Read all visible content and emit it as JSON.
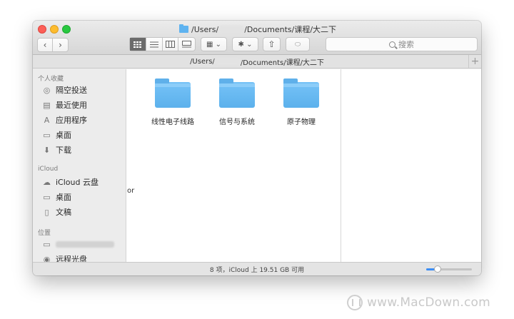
{
  "window": {
    "title_prefix": "/Users/",
    "title_suffix": "/Documents/课程/大二下"
  },
  "toolbar": {
    "back_glyph": "‹",
    "forward_glyph": "›",
    "arrange_glyph": "▦ ⌄",
    "action_glyph": "✱ ⌄",
    "share_glyph": "⇧",
    "tag_glyph": "⬭",
    "search_placeholder": "搜索"
  },
  "pathbar": {
    "prefix": "/Users/",
    "suffix": "/Documents/课程/大二下",
    "plus": "+"
  },
  "sidebar": {
    "favorites_header": "个人收藏",
    "favorites": [
      {
        "label": "隔空投送",
        "icon": "airdrop-icon",
        "glyph": "◎"
      },
      {
        "label": "最近使用",
        "icon": "recents-icon",
        "glyph": "▤"
      },
      {
        "label": "应用程序",
        "icon": "applications-icon",
        "glyph": "A"
      },
      {
        "label": "桌面",
        "icon": "desktop-icon",
        "glyph": "▭"
      },
      {
        "label": "下载",
        "icon": "downloads-icon",
        "glyph": "⬇"
      }
    ],
    "icloud_header": "iCloud",
    "icloud": [
      {
        "label": "iCloud 云盘",
        "icon": "cloud-icon",
        "glyph": "☁"
      },
      {
        "label": "桌面",
        "icon": "desktop-icon",
        "glyph": "▭"
      },
      {
        "label": "文稿",
        "icon": "documents-icon",
        "glyph": "▯"
      }
    ],
    "locations_header": "位置",
    "locations": [
      {
        "label": "",
        "icon": "computer-icon",
        "glyph": "▭"
      },
      {
        "label": "远程光盘",
        "icon": "disc-icon",
        "glyph": "◉"
      }
    ]
  },
  "content": {
    "folders": [
      {
        "name": "线性电子线路"
      },
      {
        "name": "信号与系统"
      },
      {
        "name": "原子物理"
      }
    ],
    "stray_text": "or"
  },
  "status": {
    "text": "8 项，iCloud 上 19.51 GB 可用",
    "icon_size_fraction": 0.25
  },
  "watermark": {
    "text": "www.MacDown.com"
  }
}
